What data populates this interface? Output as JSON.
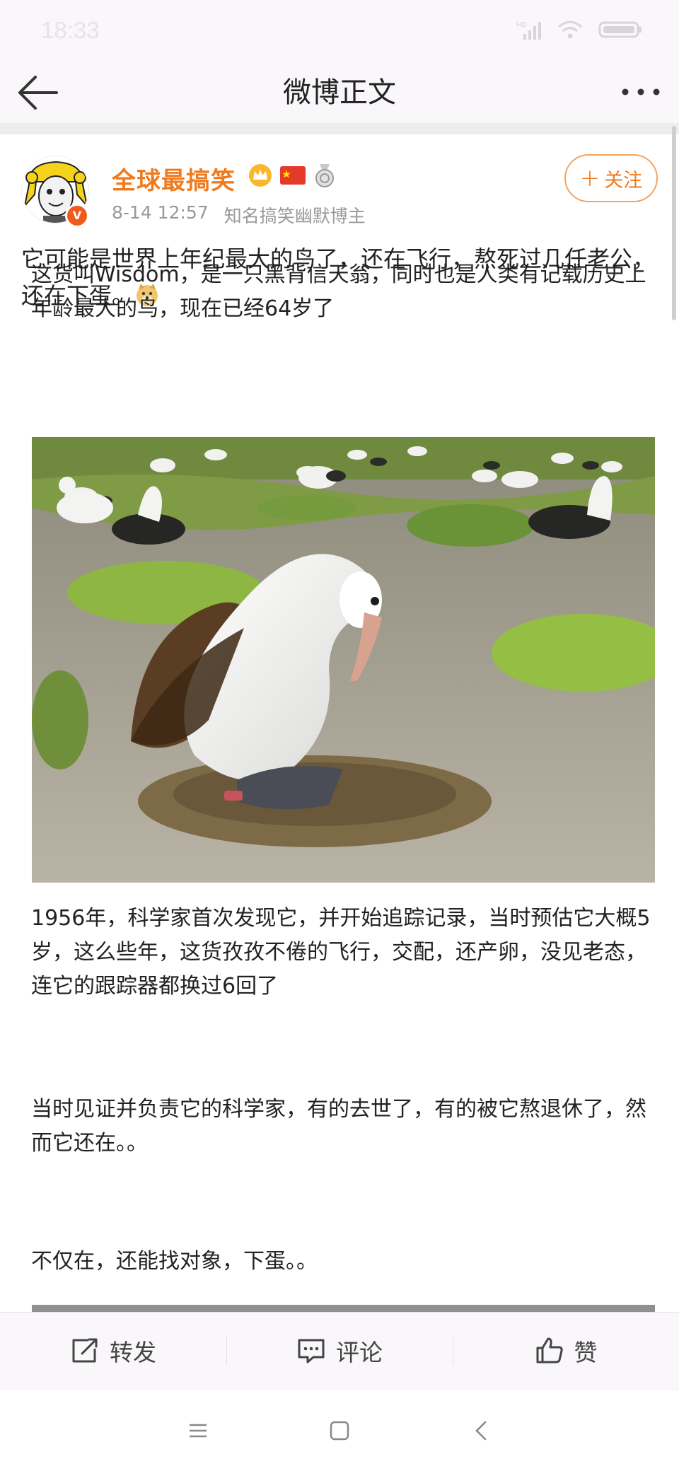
{
  "status_bar": {
    "time": "18:33",
    "network": "HD"
  },
  "header": {
    "title": "微博正文"
  },
  "author": {
    "name": "全球最搞笑",
    "time": "8-14 12:57",
    "description": "知名搞笑幽默博主",
    "follow_label": "关注",
    "verified_mark": "V"
  },
  "post": {
    "lead": "它可能是世界上年纪最大的鸟了，还在飞行，熬死过几任老公，还在下蛋。",
    "paragraphs": [
      "这货叫Wisdom，是一只黑背信天翁，同时也是人类有记载历史上年龄最大的鸟，现在已经64岁了",
      " 1956年，科学家首次发现它，并开始追踪记录，当时预估它大概5岁，这么些年，这货孜孜不倦的飞行，交配，还产卵，没见老态，连它的跟踪器都换过6回了",
      "当时见证并负责它的科学家，有的去世了，有的被它熬退休了，然而它还在。。",
      "不仅在，还能找对象，下蛋。。"
    ]
  },
  "actions": {
    "repost": "转发",
    "comment": "评论",
    "like": "赞"
  },
  "colors": {
    "accent": "#f07a1c",
    "bar_bg": "#f9f7fa"
  }
}
